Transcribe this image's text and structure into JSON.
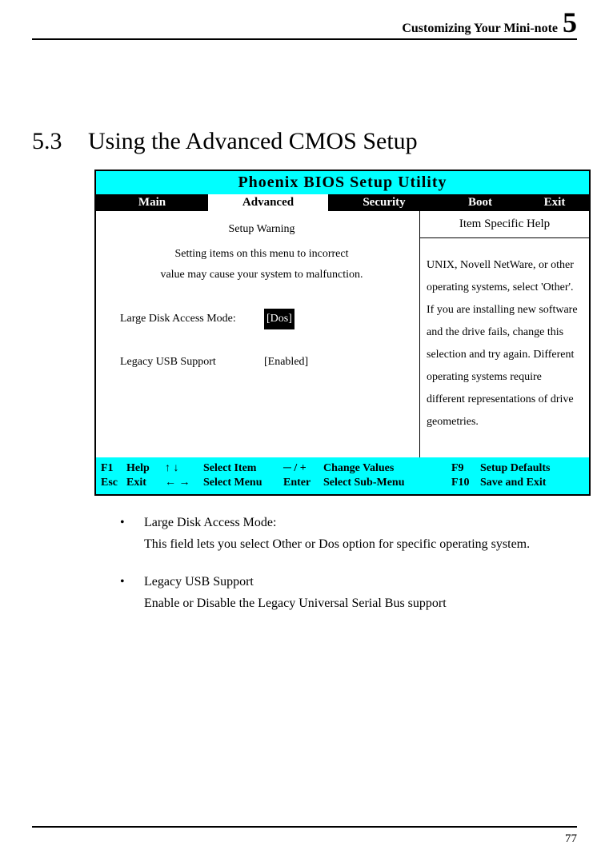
{
  "header": {
    "text": "Customizing Your Mini-note",
    "chapter": "5"
  },
  "section": {
    "number": "5.3",
    "title": "Using the Advanced CMOS Setup"
  },
  "bios": {
    "title": "Phoenix BIOS Setup Utility",
    "tabs": {
      "main": "Main",
      "advanced": "Advanced",
      "security": "Security",
      "boot": "Boot",
      "exit": "Exit"
    },
    "left": {
      "warn_title": "Setup Warning",
      "warn_line1": "Setting items on this menu to incorrect",
      "warn_line2": "value may cause your system to malfunction.",
      "setting1_label": "Large Disk Access Mode:",
      "setting1_value": "[Dos]",
      "setting2_label": "Legacy USB Support",
      "setting2_value": "[Enabled]"
    },
    "right": {
      "help_header": "Item Specific Help",
      "help_body": "UNIX, Novell NetWare, or other operating systems, select 'Other'. If you are installing new software and the drive fails, change this selection and try again. Different operating systems require different representations of drive geometries."
    },
    "footer": {
      "r1": {
        "k1": "F1",
        "l1": "Help",
        "arrows": "↑ ↓",
        "sel": "Select Item",
        "pm": "─ / +",
        "action": "Change Values",
        "k2": "F9",
        "l2": "Setup Defaults"
      },
      "r2": {
        "k1": "Esc",
        "l1": "Exit",
        "arrows": "← →",
        "sel": "Select Menu",
        "pm": "Enter",
        "action": "Select Sub-Menu",
        "k2": "F10",
        "l2": "Save and Exit"
      }
    }
  },
  "bullets": {
    "b1_title": "Large Disk Access Mode:",
    "b1_body": "This field lets you select Other or Dos option for specific operating system.",
    "b2_title": "Legacy USB Support",
    "b2_body": "Enable or Disable the Legacy Universal Serial Bus support"
  },
  "page_number": "77"
}
